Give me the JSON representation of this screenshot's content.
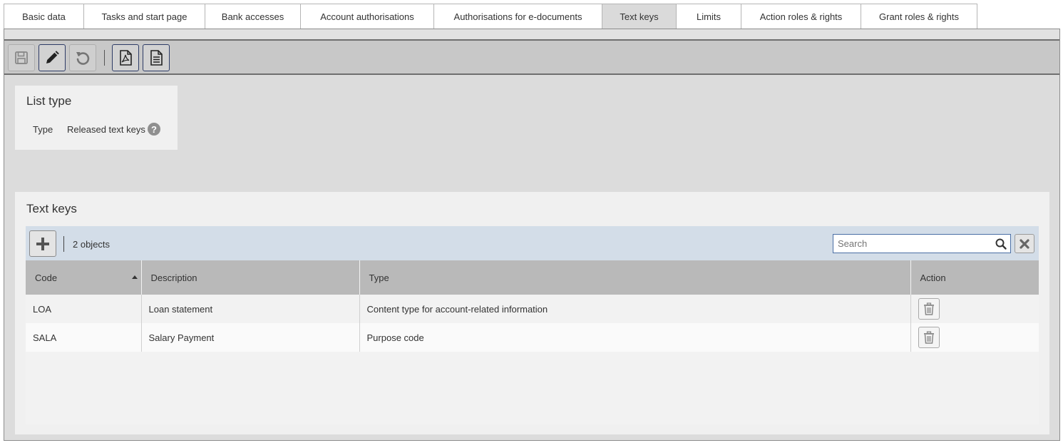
{
  "tabs": [
    {
      "label": "Basic data",
      "active": false
    },
    {
      "label": "Tasks and start page",
      "active": false
    },
    {
      "label": "Bank accesses",
      "active": false
    },
    {
      "label": "Account authorisations",
      "active": false
    },
    {
      "label": "Authorisations for e-documents",
      "active": false
    },
    {
      "label": "Text keys",
      "active": true
    },
    {
      "label": "Limits",
      "active": false
    },
    {
      "label": "Action roles & rights",
      "active": false
    },
    {
      "label": "Grant roles & rights",
      "active": false
    }
  ],
  "toolbar": {
    "buttons": [
      {
        "icon": "save-icon",
        "enabled": false
      },
      {
        "icon": "pencil-icon",
        "enabled": true
      },
      {
        "icon": "undo-icon",
        "enabled": false
      },
      {
        "icon": "pdf-icon",
        "enabled": true
      },
      {
        "icon": "document-icon",
        "enabled": true
      }
    ]
  },
  "list_type": {
    "title": "List type",
    "type_label": "Type",
    "type_value": "Released text keys",
    "help_glyph": "?"
  },
  "text_keys": {
    "title": "Text keys",
    "object_count": "2 objects",
    "search_placeholder": "Search",
    "search_value": "",
    "columns": [
      "Code",
      "Description",
      "Type",
      "Action"
    ],
    "sort_column": "Code",
    "sort_direction": "ascending",
    "rows": [
      {
        "code": "LOA",
        "description": "Loan statement",
        "type": "Content type for account-related information"
      },
      {
        "code": "SALA",
        "description": "Salary Payment",
        "type": "Purpose code"
      }
    ]
  },
  "colors": {
    "active_tab": "#dadada",
    "toolbar_bg": "#c8c8c8",
    "action_bar_bg": "#d3dde8",
    "header_bg": "#b9b9b9",
    "search_border": "#4a6fa5",
    "enabled_button_border": "#2d3b66"
  }
}
